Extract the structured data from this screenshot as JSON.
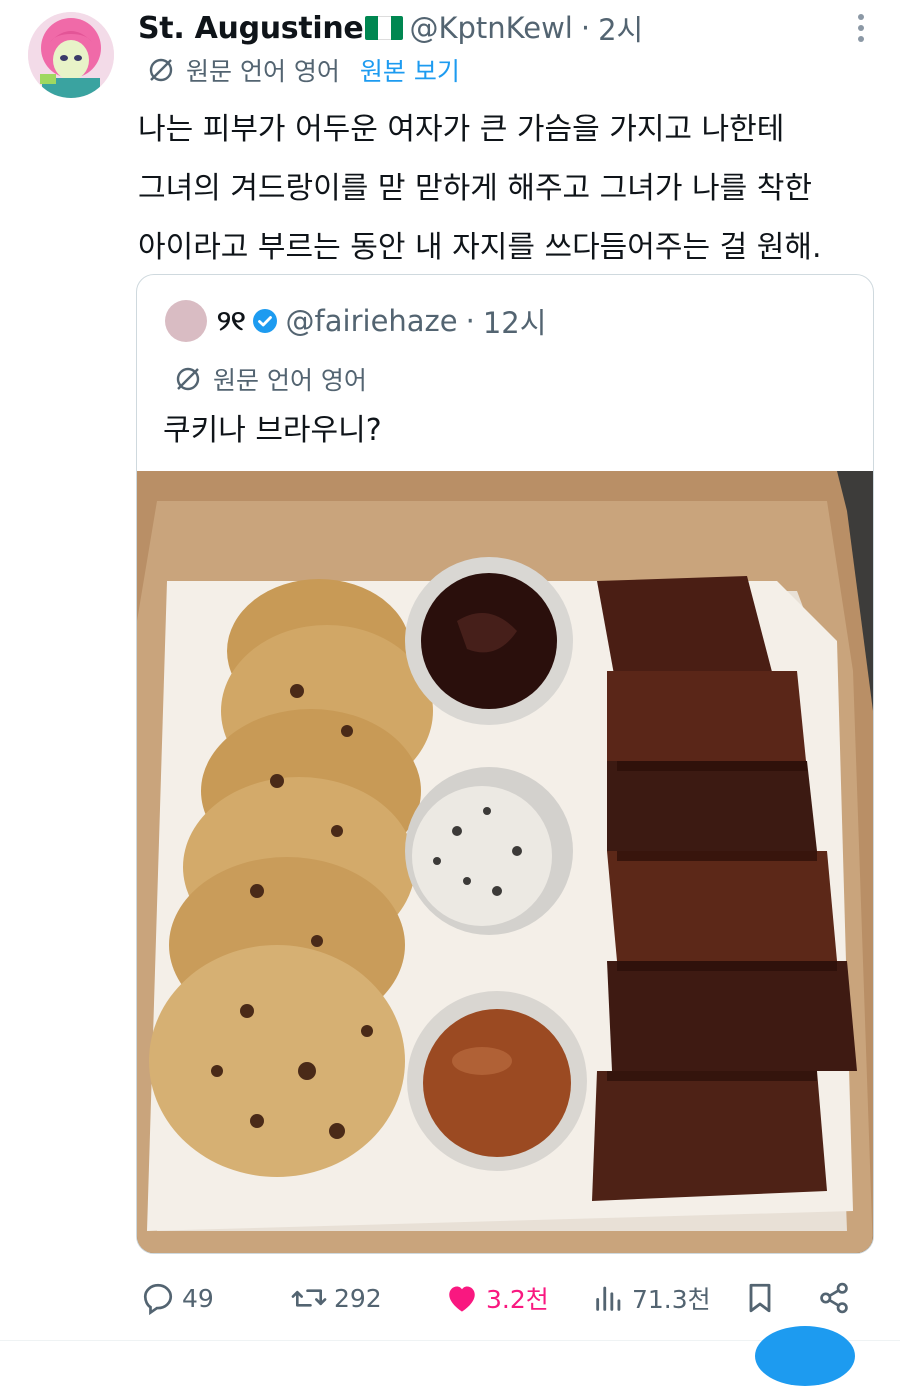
{
  "tweet": {
    "author_name": "St. Augustine",
    "flag_colors": [
      "#008751",
      "#ffffff",
      "#008751"
    ],
    "handle": "@KptnKewl",
    "separator": "·",
    "time": "2시",
    "translate": {
      "label": "원문 언어 영어",
      "link": "원본 보기"
    },
    "body_lines": [
      "나는 피부가 어두운 여자가 큰 가슴을 가지고 나한테",
      "그녀의 겨드랑이를 맏 맏하게 해주고 그녀가 나를 착한",
      "아이라고 부르는 동안 내 자지를 쓰다듬어주는 걸 원해."
    ]
  },
  "quote": {
    "author_name": "୨୧",
    "handle": "@fairiehaze",
    "separator": "·",
    "time": "12시",
    "translate_label": "원문 언어 영어",
    "text": "쿠키나 브라우니?",
    "photo_icon": "cookies-brownies-box-photo"
  },
  "actions": {
    "replies": "49",
    "retweets": "292",
    "likes": "3.2천",
    "views": "71.3천"
  },
  "colors": {
    "accent": "#1d9bf0",
    "like": "#f91880",
    "muted": "#536471",
    "verified": "#1d9bf0"
  }
}
